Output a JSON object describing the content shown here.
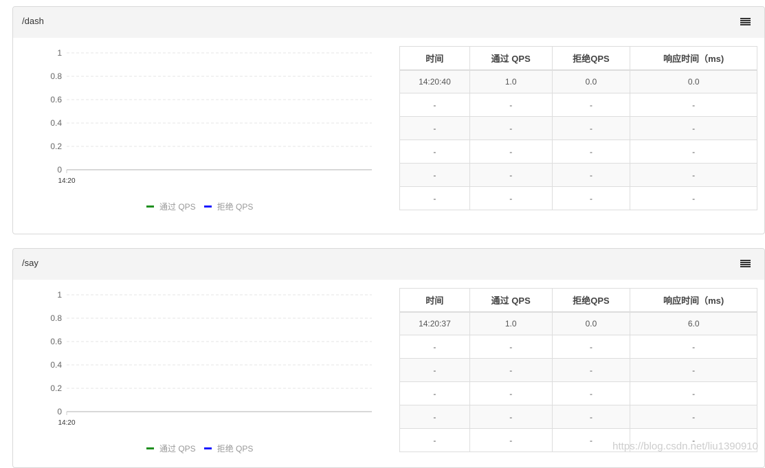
{
  "panels": [
    {
      "title": "/dash",
      "chart_data": {
        "type": "line",
        "x": [
          "14:20"
        ],
        "series": [
          {
            "name": "通过 QPS",
            "color": "#1f8f1f",
            "values": []
          },
          {
            "name": "拒绝 QPS",
            "color": "#1a1aff",
            "values": []
          }
        ],
        "yticks": [
          "0",
          "0.2",
          "0.4",
          "0.6",
          "0.8",
          "1"
        ],
        "xticks": [
          "14:20"
        ],
        "ylim": [
          0,
          1
        ],
        "grid": true,
        "legend": "bottom"
      },
      "table": {
        "headers": [
          "时间",
          "通过 QPS",
          "拒绝QPS",
          "响应时间（ms)"
        ],
        "rows": [
          [
            "14:20:40",
            "1.0",
            "0.0",
            "0.0"
          ],
          [
            "-",
            "-",
            "-",
            "-"
          ],
          [
            "-",
            "-",
            "-",
            "-"
          ],
          [
            "-",
            "-",
            "-",
            "-"
          ],
          [
            "-",
            "-",
            "-",
            "-"
          ],
          [
            "-",
            "-",
            "-",
            "-"
          ]
        ]
      }
    },
    {
      "title": "/say",
      "chart_data": {
        "type": "line",
        "x": [
          "14:20"
        ],
        "series": [
          {
            "name": "通过 QPS",
            "color": "#1f8f1f",
            "values": []
          },
          {
            "name": "拒绝 QPS",
            "color": "#1a1aff",
            "values": []
          }
        ],
        "yticks": [
          "0",
          "0.2",
          "0.4",
          "0.6",
          "0.8",
          "1"
        ],
        "xticks": [
          "14:20"
        ],
        "ylim": [
          0,
          1
        ],
        "grid": true,
        "legend": "bottom"
      },
      "table": {
        "headers": [
          "时间",
          "通过 QPS",
          "拒绝QPS",
          "响应时间（ms)"
        ],
        "rows": [
          [
            "14:20:37",
            "1.0",
            "0.0",
            "6.0"
          ],
          [
            "-",
            "-",
            "-",
            "-"
          ],
          [
            "-",
            "-",
            "-",
            "-"
          ],
          [
            "-",
            "-",
            "-",
            "-"
          ],
          [
            "-",
            "-",
            "-",
            "-"
          ],
          [
            "-",
            "-",
            "-",
            "-"
          ]
        ]
      }
    }
  ],
  "watermark": "https://blog.csdn.net/liu1390910",
  "icons": {
    "menu": "menu-icon"
  }
}
